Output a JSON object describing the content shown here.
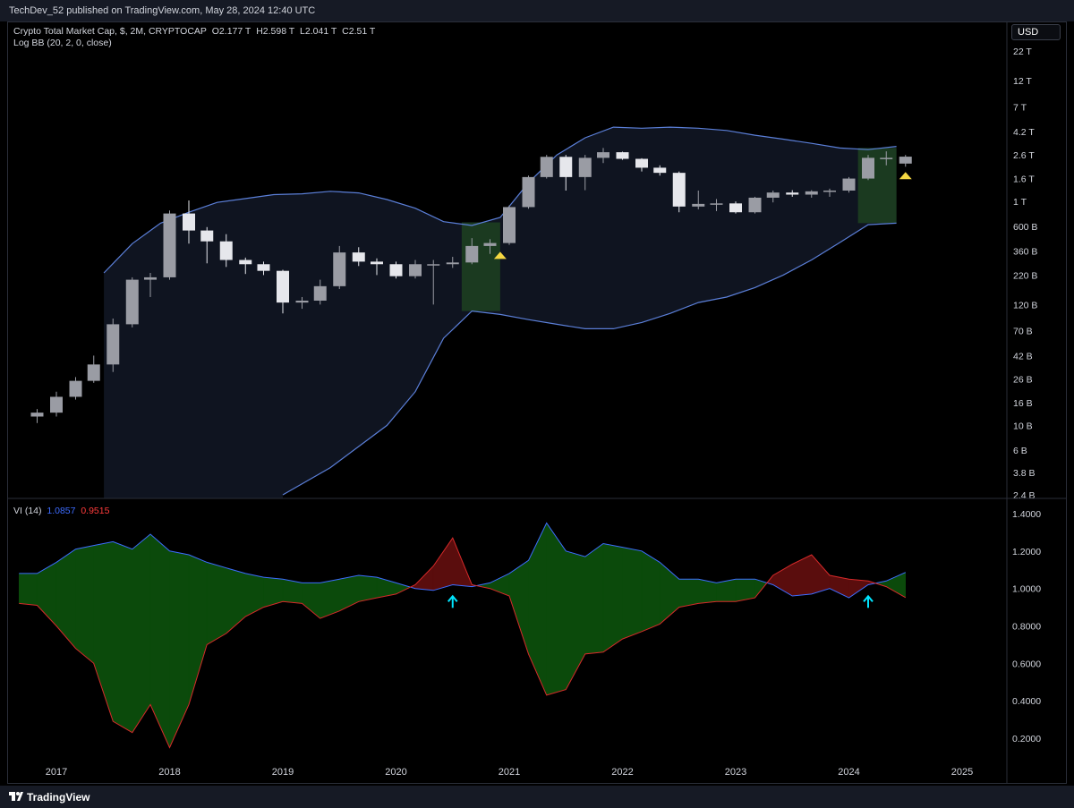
{
  "header": {
    "publisher_line": "TechDev_52 published on TradingView.com, May 28, 2024 12:40 UTC"
  },
  "legend": {
    "symbol": "Crypto Total Market Cap, $, 2M, CRYPTOCAP",
    "ohlc": {
      "o": "O2.177 T",
      "h": "H2.598 T",
      "l": "L2.041 T",
      "c": "C2.51 T"
    },
    "indicator": "Log BB (20, 2, 0, close)"
  },
  "vi_legend": {
    "label": "VI (14)",
    "plus": "1.0857",
    "minus": "0.9515"
  },
  "currency_button": "USD",
  "footer": {
    "brand": "TradingView"
  },
  "colors": {
    "background": "#000000",
    "bb_fill": "#0f1420",
    "bb_line": "#5b7fd8",
    "candle_up": "#9a9ca4",
    "candle_down": "#e6e7ec",
    "highlight": "#1b3a20",
    "vi_bull": "#0b4a0b",
    "vi_bear": "#5a0d0d",
    "arrow": "#00e5ff",
    "triangle": "#f5d742"
  },
  "chart_data": [
    {
      "type": "candlestick",
      "title": "Crypto Total Market Cap, $, 2M, CRYPTOCAP",
      "y_scale": "log",
      "y_tick_labels": [
        "22 T",
        "12 T",
        "7 T",
        "4.2 T",
        "2.6 T",
        "1.6 T",
        "1 T",
        "600 B",
        "360 B",
        "220 B",
        "120 B",
        "70 B",
        "42 B",
        "26 B",
        "16 B",
        "10 B",
        "6 B",
        "3.8 B",
        "2.4 B"
      ],
      "x_tick_labels": [
        "2017",
        "2018",
        "2019",
        "2020",
        "2021",
        "2022",
        "2023",
        "2024",
        "2025"
      ],
      "candles_billions": [
        {
          "t": 2016.83,
          "o": 12,
          "h": 14,
          "l": 10.5,
          "c": 13
        },
        {
          "t": 2017.0,
          "o": 13,
          "h": 20,
          "l": 12,
          "c": 18
        },
        {
          "t": 2017.17,
          "o": 18,
          "h": 27,
          "l": 17,
          "c": 25
        },
        {
          "t": 2017.33,
          "o": 25,
          "h": 42,
          "l": 24,
          "c": 35
        },
        {
          "t": 2017.5,
          "o": 35,
          "h": 90,
          "l": 30,
          "c": 80
        },
        {
          "t": 2017.67,
          "o": 80,
          "h": 210,
          "l": 75,
          "c": 200
        },
        {
          "t": 2017.83,
          "o": 200,
          "h": 230,
          "l": 140,
          "c": 210
        },
        {
          "t": 2018.0,
          "o": 210,
          "h": 830,
          "l": 200,
          "c": 780
        },
        {
          "t": 2018.17,
          "o": 780,
          "h": 1020,
          "l": 420,
          "c": 550
        },
        {
          "t": 2018.33,
          "o": 550,
          "h": 590,
          "l": 280,
          "c": 440
        },
        {
          "t": 2018.5,
          "o": 440,
          "h": 510,
          "l": 260,
          "c": 300
        },
        {
          "t": 2018.67,
          "o": 300,
          "h": 315,
          "l": 225,
          "c": 275
        },
        {
          "t": 2018.83,
          "o": 275,
          "h": 290,
          "l": 220,
          "c": 240
        },
        {
          "t": 2019.0,
          "o": 240,
          "h": 245,
          "l": 100,
          "c": 125
        },
        {
          "t": 2019.17,
          "o": 125,
          "h": 140,
          "l": 110,
          "c": 130
        },
        {
          "t": 2019.33,
          "o": 130,
          "h": 200,
          "l": 120,
          "c": 175
        },
        {
          "t": 2019.5,
          "o": 175,
          "h": 400,
          "l": 165,
          "c": 350
        },
        {
          "t": 2019.67,
          "o": 350,
          "h": 390,
          "l": 265,
          "c": 290
        },
        {
          "t": 2019.83,
          "o": 290,
          "h": 310,
          "l": 220,
          "c": 275
        },
        {
          "t": 2020.0,
          "o": 275,
          "h": 290,
          "l": 205,
          "c": 215
        },
        {
          "t": 2020.17,
          "o": 215,
          "h": 300,
          "l": 205,
          "c": 275
        },
        {
          "t": 2020.33,
          "o": 275,
          "h": 300,
          "l": 120,
          "c": 275
        },
        {
          "t": 2020.5,
          "o": 275,
          "h": 320,
          "l": 255,
          "c": 285
        },
        {
          "t": 2020.67,
          "o": 285,
          "h": 470,
          "l": 275,
          "c": 400
        },
        {
          "t": 2020.83,
          "o": 400,
          "h": 460,
          "l": 340,
          "c": 425
        },
        {
          "t": 2021.0,
          "o": 425,
          "h": 920,
          "l": 410,
          "c": 890
        },
        {
          "t": 2021.17,
          "o": 890,
          "h": 1700,
          "l": 860,
          "c": 1650
        },
        {
          "t": 2021.33,
          "o": 1650,
          "h": 2600,
          "l": 1600,
          "c": 2500
        },
        {
          "t": 2021.5,
          "o": 2500,
          "h": 2600,
          "l": 1250,
          "c": 1650
        },
        {
          "t": 2021.67,
          "o": 1650,
          "h": 2600,
          "l": 1260,
          "c": 2450
        },
        {
          "t": 2021.83,
          "o": 2450,
          "h": 3000,
          "l": 2200,
          "c": 2750
        },
        {
          "t": 2022.0,
          "o": 2750,
          "h": 2780,
          "l": 2350,
          "c": 2400
        },
        {
          "t": 2022.17,
          "o": 2400,
          "h": 2430,
          "l": 1850,
          "c": 2000
        },
        {
          "t": 2022.33,
          "o": 2000,
          "h": 2100,
          "l": 1700,
          "c": 1800
        },
        {
          "t": 2022.5,
          "o": 1800,
          "h": 1850,
          "l": 800,
          "c": 900
        },
        {
          "t": 2022.67,
          "o": 900,
          "h": 1250,
          "l": 850,
          "c": 950
        },
        {
          "t": 2022.83,
          "o": 950,
          "h": 1050,
          "l": 820,
          "c": 960
        },
        {
          "t": 2023.0,
          "o": 960,
          "h": 1000,
          "l": 780,
          "c": 800
        },
        {
          "t": 2023.17,
          "o": 800,
          "h": 1100,
          "l": 780,
          "c": 1080
        },
        {
          "t": 2023.33,
          "o": 1080,
          "h": 1250,
          "l": 980,
          "c": 1200
        },
        {
          "t": 2023.5,
          "o": 1200,
          "h": 1260,
          "l": 1100,
          "c": 1150
        },
        {
          "t": 2023.67,
          "o": 1150,
          "h": 1260,
          "l": 1080,
          "c": 1230
        },
        {
          "t": 2023.83,
          "o": 1230,
          "h": 1300,
          "l": 1100,
          "c": 1250
        },
        {
          "t": 2024.0,
          "o": 1250,
          "h": 1650,
          "l": 1200,
          "c": 1600
        },
        {
          "t": 2024.17,
          "o": 1600,
          "h": 2600,
          "l": 1550,
          "c": 2450
        },
        {
          "t": 2024.33,
          "o": 2450,
          "h": 2800,
          "l": 2100,
          "c": 2450
        },
        {
          "t": 2024.5,
          "o": 2177,
          "h": 2598,
          "l": 2041,
          "c": 2510
        }
      ],
      "bollinger_upper_billions": [
        {
          "t": 2017.42,
          "v": 230
        },
        {
          "t": 2017.67,
          "v": 420
        },
        {
          "t": 2017.92,
          "v": 640
        },
        {
          "t": 2018.17,
          "v": 800
        },
        {
          "t": 2018.42,
          "v": 980
        },
        {
          "t": 2018.67,
          "v": 1060
        },
        {
          "t": 2018.92,
          "v": 1150
        },
        {
          "t": 2019.17,
          "v": 1170
        },
        {
          "t": 2019.42,
          "v": 1230
        },
        {
          "t": 2019.67,
          "v": 1190
        },
        {
          "t": 2019.92,
          "v": 1040
        },
        {
          "t": 2020.17,
          "v": 870
        },
        {
          "t": 2020.42,
          "v": 660
        },
        {
          "t": 2020.67,
          "v": 610
        },
        {
          "t": 2020.92,
          "v": 720
        },
        {
          "t": 2021.17,
          "v": 1470
        },
        {
          "t": 2021.42,
          "v": 2600
        },
        {
          "t": 2021.67,
          "v": 3700
        },
        {
          "t": 2021.92,
          "v": 4600
        },
        {
          "t": 2022.17,
          "v": 4500
        },
        {
          "t": 2022.42,
          "v": 4600
        },
        {
          "t": 2022.67,
          "v": 4500
        },
        {
          "t": 2022.92,
          "v": 4300
        },
        {
          "t": 2023.17,
          "v": 3900
        },
        {
          "t": 2023.42,
          "v": 3600
        },
        {
          "t": 2023.67,
          "v": 3300
        },
        {
          "t": 2023.92,
          "v": 3000
        },
        {
          "t": 2024.17,
          "v": 2900
        },
        {
          "t": 2024.42,
          "v": 3100
        }
      ],
      "bollinger_lower_billions": [
        {
          "t": 2019.0,
          "v": 2.4
        },
        {
          "t": 2019.42,
          "v": 4.2
        },
        {
          "t": 2019.92,
          "v": 10
        },
        {
          "t": 2020.17,
          "v": 20
        },
        {
          "t": 2020.42,
          "v": 60
        },
        {
          "t": 2020.67,
          "v": 105
        },
        {
          "t": 2020.92,
          "v": 98
        },
        {
          "t": 2021.17,
          "v": 88
        },
        {
          "t": 2021.42,
          "v": 80
        },
        {
          "t": 2021.67,
          "v": 73
        },
        {
          "t": 2021.92,
          "v": 73
        },
        {
          "t": 2022.17,
          "v": 83
        },
        {
          "t": 2022.42,
          "v": 100
        },
        {
          "t": 2022.67,
          "v": 125
        },
        {
          "t": 2022.92,
          "v": 140
        },
        {
          "t": 2023.17,
          "v": 170
        },
        {
          "t": 2023.42,
          "v": 220
        },
        {
          "t": 2023.67,
          "v": 300
        },
        {
          "t": 2023.92,
          "v": 430
        },
        {
          "t": 2024.17,
          "v": 620
        },
        {
          "t": 2024.42,
          "v": 640
        }
      ],
      "highlight_ranges": [
        [
          2020.58,
          2020.92
        ],
        [
          2024.08,
          2024.42
        ]
      ],
      "signal_markers": [
        {
          "t": 2020.92,
          "v": 330
        },
        {
          "t": 2024.5,
          "v": 1700
        }
      ]
    },
    {
      "type": "area",
      "title": "VI (14)",
      "y_tick_labels": [
        "1.4000",
        "1.2000",
        "1.0000",
        "0.8000",
        "0.6000",
        "0.4000",
        "0.2000"
      ],
      "ylim": [
        0.1,
        1.45
      ],
      "series": [
        {
          "name": "VI+",
          "x": [
            2016.67,
            2016.83,
            2017.0,
            2017.17,
            2017.33,
            2017.5,
            2017.67,
            2017.83,
            2018.0,
            2018.17,
            2018.33,
            2018.5,
            2018.67,
            2018.83,
            2019.0,
            2019.17,
            2019.33,
            2019.5,
            2019.67,
            2019.83,
            2020.0,
            2020.17,
            2020.33,
            2020.5,
            2020.67,
            2020.83,
            2021.0,
            2021.17,
            2021.33,
            2021.5,
            2021.67,
            2021.83,
            2022.0,
            2022.17,
            2022.33,
            2022.5,
            2022.67,
            2022.83,
            2023.0,
            2023.17,
            2023.33,
            2023.5,
            2023.67,
            2023.83,
            2024.0,
            2024.17,
            2024.33,
            2024.5
          ],
          "values": [
            1.08,
            1.08,
            1.14,
            1.21,
            1.23,
            1.25,
            1.21,
            1.29,
            1.2,
            1.18,
            1.14,
            1.11,
            1.08,
            1.06,
            1.05,
            1.03,
            1.03,
            1.05,
            1.07,
            1.06,
            1.03,
            1.0,
            0.99,
            1.02,
            1.01,
            1.03,
            1.08,
            1.15,
            1.35,
            1.2,
            1.17,
            1.24,
            1.22,
            1.2,
            1.14,
            1.05,
            1.05,
            1.03,
            1.05,
            1.05,
            1.02,
            0.96,
            0.97,
            1.0,
            0.95,
            1.02,
            1.04,
            1.0857
          ]
        },
        {
          "name": "VI-",
          "x": [
            2016.67,
            2016.83,
            2017.0,
            2017.17,
            2017.33,
            2017.5,
            2017.67,
            2017.83,
            2018.0,
            2018.17,
            2018.33,
            2018.5,
            2018.67,
            2018.83,
            2019.0,
            2019.17,
            2019.33,
            2019.5,
            2019.67,
            2019.83,
            2020.0,
            2020.17,
            2020.33,
            2020.5,
            2020.67,
            2020.83,
            2021.0,
            2021.17,
            2021.33,
            2021.5,
            2021.67,
            2021.83,
            2022.0,
            2022.17,
            2022.33,
            2022.5,
            2022.67,
            2022.83,
            2023.0,
            2023.17,
            2023.33,
            2023.5,
            2023.67,
            2023.83,
            2024.0,
            2024.17,
            2024.33,
            2024.5
          ],
          "values": [
            0.92,
            0.91,
            0.8,
            0.68,
            0.6,
            0.29,
            0.23,
            0.38,
            0.15,
            0.38,
            0.7,
            0.76,
            0.85,
            0.9,
            0.93,
            0.92,
            0.84,
            0.88,
            0.93,
            0.95,
            0.97,
            1.02,
            1.12,
            1.27,
            1.02,
            1.0,
            0.96,
            0.65,
            0.43,
            0.46,
            0.65,
            0.66,
            0.73,
            0.77,
            0.81,
            0.9,
            0.92,
            0.93,
            0.93,
            0.95,
            1.07,
            1.13,
            1.18,
            1.07,
            1.05,
            1.04,
            1.01,
            0.9515
          ]
        }
      ],
      "signal_markers": [
        {
          "t": 2020.5,
          "v": 0.93
        },
        {
          "t": 2024.17,
          "v": 0.93
        }
      ]
    }
  ]
}
